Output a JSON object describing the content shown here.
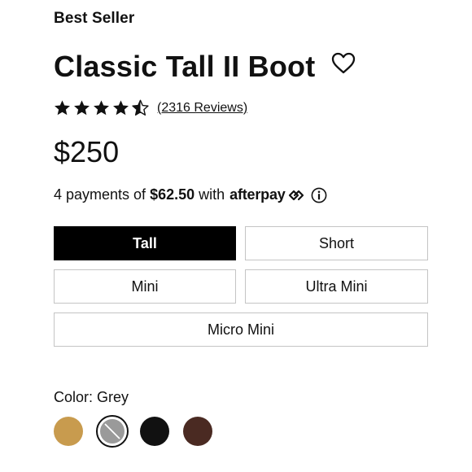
{
  "badge": "Best Seller",
  "product": {
    "title": "Classic Tall II Boot",
    "rating": 4.5,
    "rating_max": 5,
    "reviews_label": "(2316 Reviews)",
    "price": "$250"
  },
  "installments": {
    "prefix": "4 payments of",
    "amount": "$62.50",
    "middle": "with",
    "provider": "afterpay"
  },
  "sizes": {
    "tall": "Tall",
    "short": "Short",
    "mini": "Mini",
    "ultra_mini": "Ultra Mini",
    "micro_mini": "Micro Mini",
    "selected": "Tall"
  },
  "color": {
    "label": "Color: Grey",
    "swatches": [
      {
        "name": "chestnut",
        "hex": "#c89b4e"
      },
      {
        "name": "grey",
        "hex": "#9a9a9a",
        "selected": true
      },
      {
        "name": "black",
        "hex": "#111111"
      },
      {
        "name": "chocolate",
        "hex": "#4a2a22"
      }
    ]
  },
  "icons": {
    "favorite": "heart-outline-icon",
    "star_full": "star-icon",
    "star_half": "star-half-icon",
    "info": "info-icon"
  },
  "colors": {
    "text": "#111111",
    "selected_bg": "#000000",
    "border": "#c4c4c4"
  }
}
